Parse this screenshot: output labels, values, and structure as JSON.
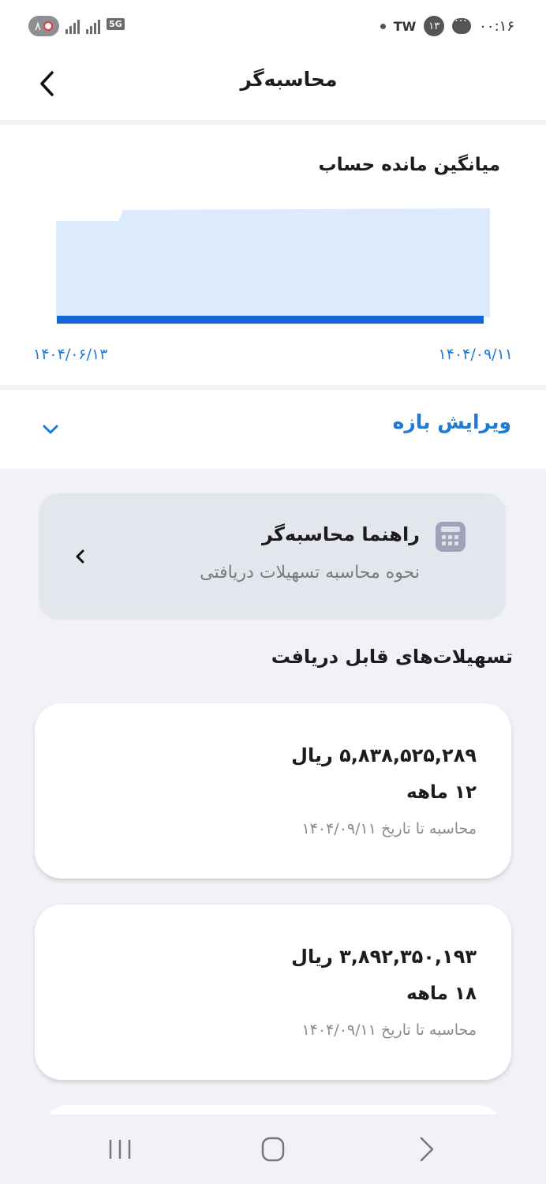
{
  "status_bar": {
    "badge_count": "۸",
    "network": "5G",
    "carrier": "TW",
    "notif_count": "۱۳",
    "time": "۰۰:۱۶"
  },
  "header": {
    "title": "محاسبه‌گر"
  },
  "chart": {
    "title": "میانگین مانده حساب",
    "start_date": "۱۴۰۴/۰۶/۱۳",
    "end_date": "۱۴۰۴/۰۹/۱۱",
    "fill_color": "#dcebfc",
    "line_color": "#1565d8"
  },
  "range": {
    "label": "ویرایش بازه"
  },
  "guide": {
    "title": "راهنما محاسبه‌گر",
    "subtitle": "نحوه محاسبه تسهیلات دریافتی"
  },
  "facilities": {
    "section_title": "تسهیلات‌های قابل دریافت",
    "items": [
      {
        "amount": "۵,۸۳۸,۵۲۵,۲۸۹ ریال",
        "term": "۱۲ ماهه",
        "date_note": "محاسبه تا تاریخ ۱۴۰۴/۰۹/۱۱"
      },
      {
        "amount": "۳,۸۹۲,۳۵۰,۱۹۳ ریال",
        "term": "۱۸ ماهه",
        "date_note": "محاسبه تا تاریخ ۱۴۰۴/۰۹/۱۱"
      }
    ]
  }
}
